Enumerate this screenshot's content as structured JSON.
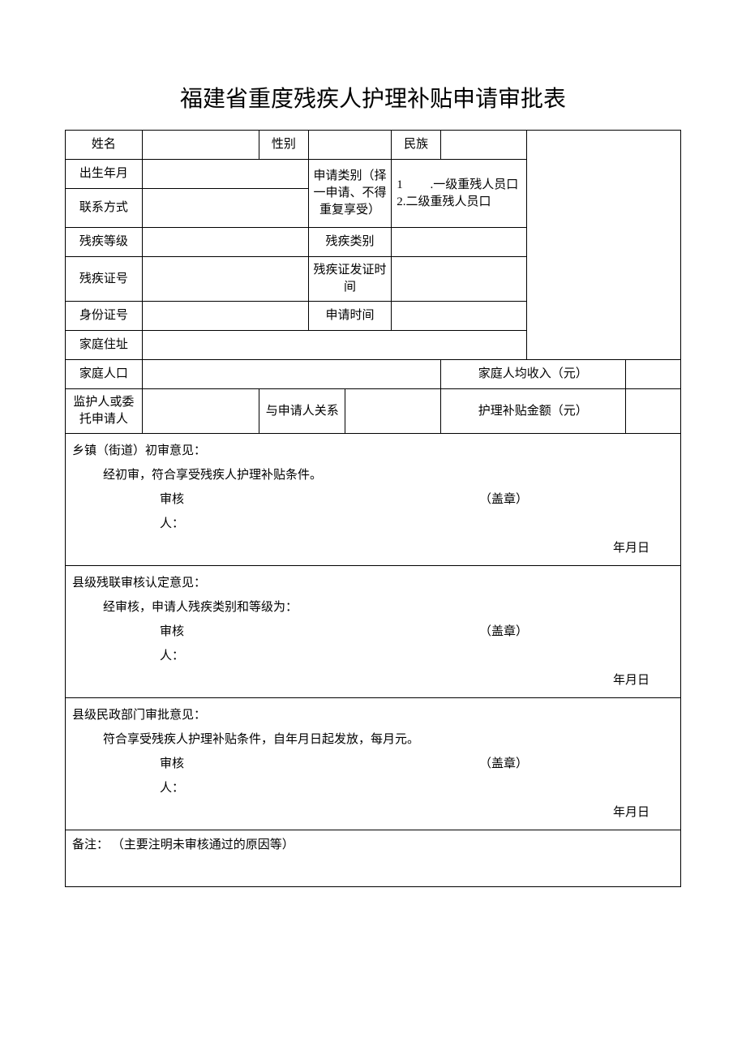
{
  "title": "福建省重度残疾人护理补贴申请审批表",
  "labels": {
    "name": "姓名",
    "gender": "性别",
    "ethnic": "民族",
    "dob": "出生年月",
    "contact": "联系方式",
    "applyType": "申请类别（择一申请、不得重复享受）",
    "applyOptions": "1         .一级重残人员口\n2.二级重残人员口",
    "disLevel": "残疾等级",
    "disCat": "残疾类别",
    "disCert": "残疾证号",
    "certDate": "残疾证发证时间",
    "idNo": "身份证号",
    "applyTime": "申请时间",
    "addr": "家庭住址",
    "famPop": "家庭人口",
    "famIncome": "家庭人均收入（元）",
    "guardian": "监护人或委托申请人",
    "relation": "与申请人关系",
    "subsidy": "护理补贴金额（元）"
  },
  "sections": {
    "town": {
      "header": "乡镇（街道）初审意见：",
      "body": "经初审，符合享受残疾人护理补贴条件。",
      "reviewer": "审核人：",
      "seal": "（盖章）",
      "date": "年月日"
    },
    "county_dpf": {
      "header": "县级残联审核认定意见：",
      "body": "经审核，申请人残疾类别和等级为：",
      "reviewer": "审核人：",
      "seal": "（盖章）",
      "date": "年月日"
    },
    "county_civil": {
      "header": "县级民政部门审批意见：",
      "body": "符合享受残疾人护理补贴条件，自年月日起发放，每月元。",
      "reviewer": "审核人：",
      "seal": "（盖章）",
      "date": "年月日"
    },
    "remarks": "备注： （主要注明未审核通过的原因等）"
  }
}
